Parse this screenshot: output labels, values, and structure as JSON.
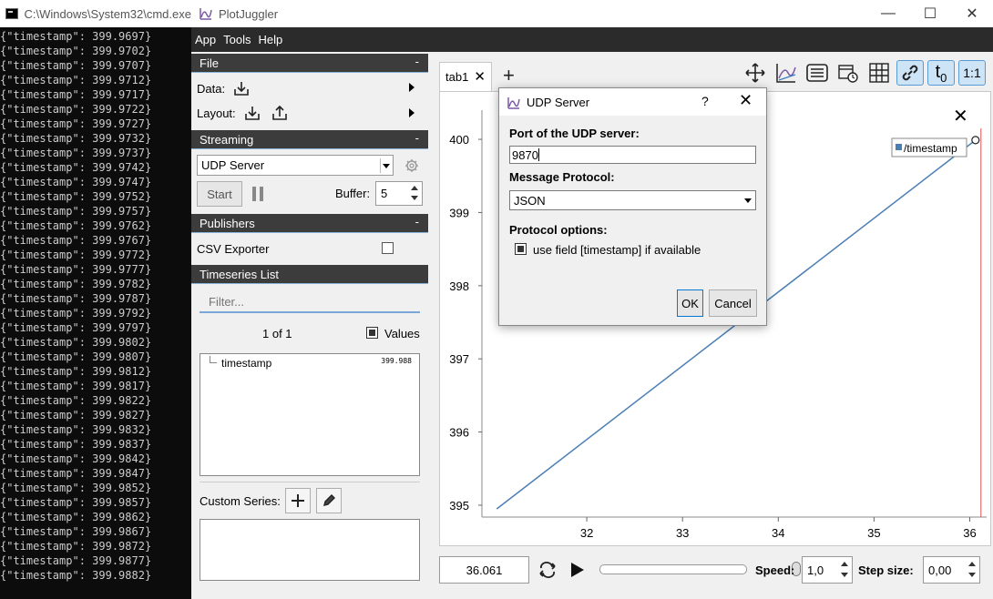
{
  "cmd": {
    "title": "C:\\Windows\\System32\\cmd.exe",
    "lines": [
      "{\"timestamp\": 399.9697}",
      "{\"timestamp\": 399.9702}",
      "{\"timestamp\": 399.9707}",
      "{\"timestamp\": 399.9712}",
      "{\"timestamp\": 399.9717}",
      "{\"timestamp\": 399.9722}",
      "{\"timestamp\": 399.9727}",
      "{\"timestamp\": 399.9732}",
      "{\"timestamp\": 399.9737}",
      "{\"timestamp\": 399.9742}",
      "{\"timestamp\": 399.9747}",
      "{\"timestamp\": 399.9752}",
      "{\"timestamp\": 399.9757}",
      "{\"timestamp\": 399.9762}",
      "{\"timestamp\": 399.9767}",
      "{\"timestamp\": 399.9772}",
      "{\"timestamp\": 399.9777}",
      "{\"timestamp\": 399.9782}",
      "{\"timestamp\": 399.9787}",
      "{\"timestamp\": 399.9792}",
      "{\"timestamp\": 399.9797}",
      "{\"timestamp\": 399.9802}",
      "{\"timestamp\": 399.9807}",
      "{\"timestamp\": 399.9812}",
      "{\"timestamp\": 399.9817}",
      "{\"timestamp\": 399.9822}",
      "{\"timestamp\": 399.9827}",
      "{\"timestamp\": 399.9832}",
      "{\"timestamp\": 399.9837}",
      "{\"timestamp\": 399.9842}",
      "{\"timestamp\": 399.9847}",
      "{\"timestamp\": 399.9852}",
      "{\"timestamp\": 399.9857}",
      "{\"timestamp\": 399.9862}",
      "{\"timestamp\": 399.9867}",
      "{\"timestamp\": 399.9872}",
      "{\"timestamp\": 399.9877}",
      "{\"timestamp\": 399.9882}"
    ]
  },
  "app": {
    "title": "PlotJuggler",
    "window_controls": {
      "minimize": "—",
      "maximize": "☐",
      "close": "✕"
    },
    "menu": [
      "App",
      "Tools",
      "Help"
    ]
  },
  "left": {
    "file": {
      "header": "File",
      "collapse": "-",
      "data_label": "Data:",
      "layout_label": "Layout:"
    },
    "streaming": {
      "header": "Streaming",
      "collapse": "-",
      "source": "UDP Server",
      "start_label": "Start",
      "buffer_label": "Buffer:",
      "buffer_value": "5"
    },
    "publishers": {
      "header": "Publishers",
      "collapse": "-",
      "csv_label": "CSV Exporter"
    },
    "timeseries": {
      "header": "Timeseries List",
      "filter_placeholder": "Filter...",
      "page": "1 of 1",
      "values_label": "Values",
      "items": [
        {
          "name": "timestamp",
          "value": "399.988"
        }
      ],
      "custom_series_label": "Custom Series:"
    }
  },
  "plot": {
    "tab_label": "tab1",
    "tab_close": "✕",
    "add_tab": "+",
    "close_plot": "✕",
    "legend": "/timestamp",
    "accent": "#4a7fb5"
  },
  "chart_data": {
    "type": "line",
    "series": [
      {
        "name": "/timestamp",
        "x": [
          31.06,
          36.06
        ],
        "y": [
          394.95,
          399.99
        ]
      }
    ],
    "xticks": [
      32,
      33,
      34,
      35,
      36
    ],
    "yticks": [
      395,
      396,
      397,
      398,
      399,
      400
    ],
    "xlim": [
      31.0,
      36.1
    ],
    "ylim": [
      394.9,
      400.15
    ],
    "grid": false,
    "legend_position": "top-right"
  },
  "bottom": {
    "time_value": "36.061",
    "speed_label": "Speed:",
    "speed_value": "1,0",
    "step_label": "Step size:",
    "step_value": "0,00",
    "slider_fraction": 0.0
  },
  "dialog": {
    "title": "UDP Server",
    "help": "?",
    "close": "✕",
    "port_label": "Port of the UDP server:",
    "port_value": "9870",
    "protocol_label": "Message Protocol:",
    "protocol_value": "JSON",
    "options_label": "Protocol options:",
    "use_timestamp_label": "use field [timestamp] if available",
    "ok_label": "OK",
    "cancel_label": "Cancel"
  }
}
